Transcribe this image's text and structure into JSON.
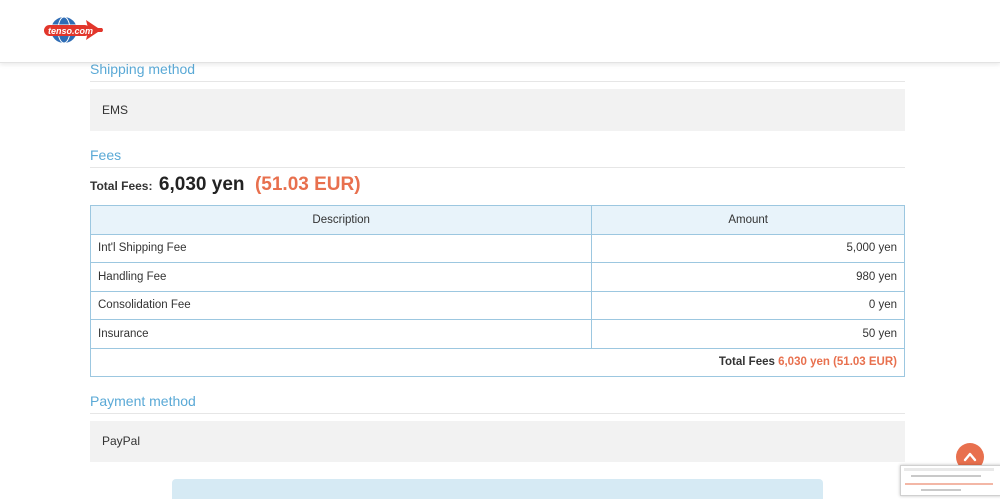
{
  "header": {
    "logo_text": "tenso.com"
  },
  "shipping": {
    "title": "Shipping method",
    "value": "EMS"
  },
  "fees": {
    "title": "Fees",
    "total_label": "Total Fees:",
    "total_yen": "6,030 yen",
    "total_eur": "(51.03 EUR)",
    "table": {
      "headers": [
        "Description",
        "Amount"
      ],
      "rows": [
        {
          "description": "Int'l Shipping Fee",
          "amount": "5,000 yen"
        },
        {
          "description": "Handling Fee",
          "amount": "980 yen"
        },
        {
          "description": "Consolidation Fee",
          "amount": "0 yen"
        },
        {
          "description": "Insurance",
          "amount": "50 yen"
        }
      ],
      "total_label": "Total Fees",
      "total_value": "6,030 yen (51.03 EUR)"
    }
  },
  "payment": {
    "title": "Payment method",
    "value": "PayPal"
  },
  "colors": {
    "accent_blue": "#5aa9d6",
    "accent_orange": "#e8704e",
    "table_border": "#9cc7e0"
  },
  "icons": {
    "scroll_top": "chevron-up-icon",
    "logo": "airplane-globe-logo"
  }
}
